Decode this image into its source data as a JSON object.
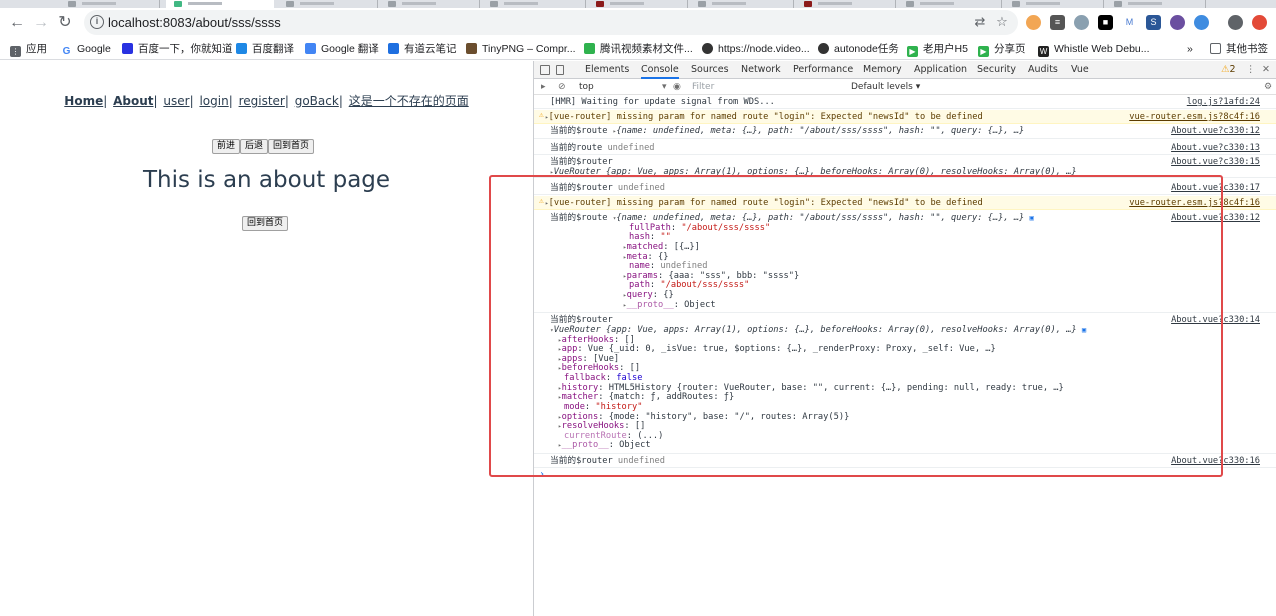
{
  "browser": {
    "url": "localhost:8083/about/sss/ssss",
    "bookmarks": [
      {
        "label": "应用",
        "color": "#5f6368"
      },
      {
        "label": "Google",
        "color": "#4285f4"
      },
      {
        "label": "百度一下，你就知道",
        "color": "#2932e1"
      },
      {
        "label": "百度翻译",
        "color": "#1e88e5"
      },
      {
        "label": "Google 翻译",
        "color": "#4285f4"
      },
      {
        "label": "有道云笔记",
        "color": "#1e6fe0"
      },
      {
        "label": "TinyPNG – Compr...",
        "color": "#6b4e2e"
      },
      {
        "label": "腾讯视频素材文件...",
        "color": "#2fb24e"
      },
      {
        "label": "https://node.video...",
        "color": "#333333"
      },
      {
        "label": "autonode任务",
        "color": "#333333"
      },
      {
        "label": "老用户H5",
        "color": "#2fb24e"
      },
      {
        "label": "分享页",
        "color": "#2fb24e"
      },
      {
        "label": "Whistle Web Debu...",
        "color": "#222222"
      },
      {
        "label": "其他书签",
        "color": "#5f6368"
      }
    ],
    "more_bookmarks": "»"
  },
  "page": {
    "nav_links": [
      "Home",
      "About",
      "user",
      "login",
      "register",
      "goBack",
      "这是一个不存在的页面"
    ],
    "btn_forward": "前进",
    "btn_back": "后退",
    "btn_home": "回到首页",
    "heading": "This is an about page",
    "btn_home2": "回到首页"
  },
  "devtools": {
    "tabs": [
      "Elements",
      "Console",
      "Sources",
      "Network",
      "Performance",
      "Memory",
      "Application",
      "Security",
      "Audits",
      "Vue"
    ],
    "active_tab": "Console",
    "warn_count": "2",
    "context": "top",
    "filter_placeholder": "Filter",
    "levels": "Default levels ▾",
    "accent": "#e0494a"
  },
  "console": {
    "r1": {
      "msg": "[HMR] Waiting for update signal from WDS...",
      "src": "log.js?1afd:24"
    },
    "r2": {
      "msg": "[vue-router] missing param for named route \"login\": Expected \"newsId\" to be defined",
      "src": "vue-router.esm.js?8c4f:16"
    },
    "r3": {
      "label": "当前的$route",
      "obj": "{name: undefined, meta: {…}, path: \"/about/sss/ssss\", hash: \"\", query: {…}, …}",
      "src": "About.vue?c330:12"
    },
    "r4": {
      "label": "当前的route",
      "val": "undefined",
      "src": "About.vue?c330:13"
    },
    "r5": {
      "label": "当前的$router",
      "obj": "VueRouter {app: Vue, apps: Array(1), options: {…}, beforeHooks: Array(0), resolveHooks: Array(0), …}",
      "src": "About.vue?c330:15"
    },
    "r6": {
      "label": "当前的$router",
      "val": "undefined",
      "src": "About.vue?c330:17"
    },
    "r7": {
      "msg": "[vue-router] missing param for named route \"login\": Expected \"newsId\" to be defined",
      "src": "vue-router.esm.js?8c4f:16"
    },
    "r8": {
      "label": "当前的$route",
      "obj": "{name: undefined, meta: {…}, path: \"/about/sss/ssss\", hash: \"\", query: {…}, …}",
      "src": "About.vue?c330:12",
      "fullPath": "\"/about/sss/ssss\"",
      "hash": "\"\"",
      "matched": "[{…}]",
      "meta": "{}",
      "name": "undefined",
      "params": "{aaa: \"sss\", bbb: \"ssss\"}",
      "path": "\"/about/sss/ssss\"",
      "query": "{}",
      "proto": "Object"
    },
    "r9": {
      "label": "当前的$router",
      "src": "About.vue?c330:14",
      "head": "VueRouter {app: Vue, apps: Array(1), options: {…}, beforeHooks: Array(0), resolveHooks: Array(0), …}",
      "afterHooks": "[]",
      "app": "Vue {_uid: 0, _isVue: true, $options: {…}, _renderProxy: Proxy, _self: Vue, …}",
      "apps": "[Vue]",
      "beforeHooks": "[]",
      "fallback": "false",
      "history": "HTML5History {router: VueRouter, base: \"\", current: {…}, pending: null, ready: true, …}",
      "matcher": "{match: ƒ, addRoutes: ƒ}",
      "mode": "\"history\"",
      "options": "{mode: \"history\", base: \"/\", routes: Array(5)}",
      "resolveHooks": "[]",
      "currentRoute": "(...)",
      "proto": "Object"
    },
    "r10": {
      "label": "当前的$router",
      "val": "undefined",
      "src": "About.vue?c330:16"
    },
    "prompt": "›"
  }
}
